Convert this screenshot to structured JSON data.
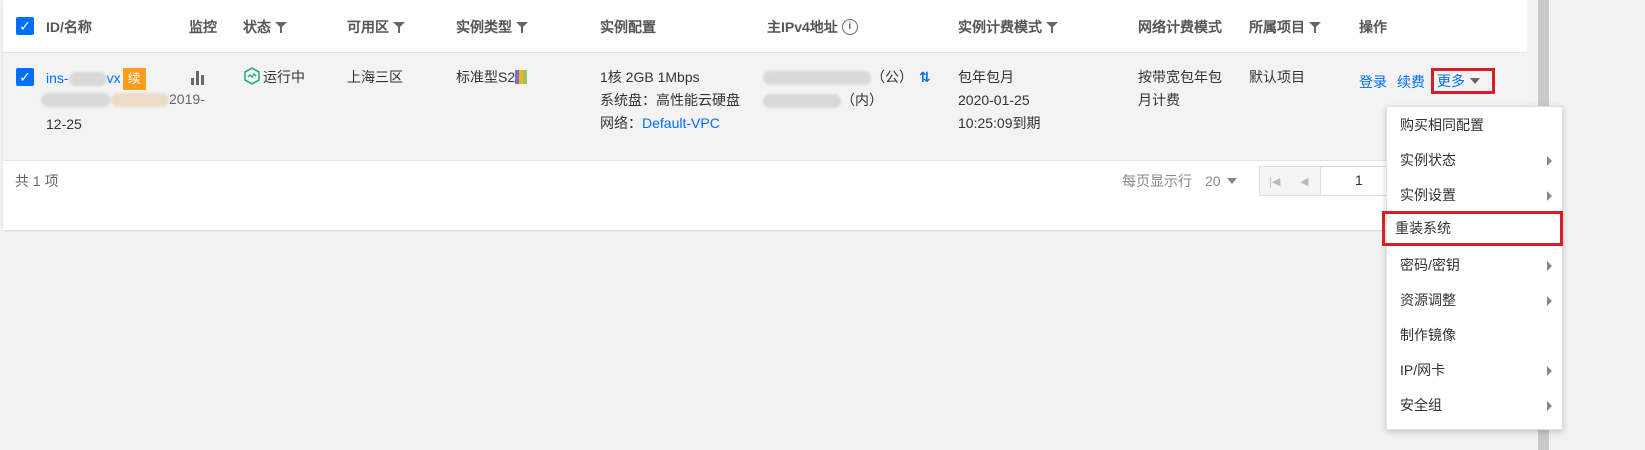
{
  "table": {
    "headers": {
      "id_name": "ID/名称",
      "monitor": "监控",
      "status": "状态",
      "zone": "可用区",
      "instance_type": "实例类型",
      "instance_config": "实例配置",
      "primary_ipv4": "主IPv4地址",
      "billing_mode": "实例计费模式",
      "network_billing": "网络计费模式",
      "project": "所属项目",
      "actions": "操作"
    },
    "row": {
      "id_prefix": "ins-",
      "id_suffix": "vx",
      "renew_badge": "续",
      "name_line2_tail": "2019-",
      "name_line3": "12-25",
      "status": "运行中",
      "zone": "上海三区",
      "instance_type": "标准型S2",
      "config_line1": "1核 2GB 1Mbps",
      "config_line2": "系统盘：高性能云硬盘",
      "config_line3_label": "网络：",
      "config_line3_link": "Default-VPC",
      "ip_public_suffix": "（公）",
      "ip_private_suffix": "（内）",
      "billing_line1": "包年包月",
      "billing_line2": "2020-01-25",
      "billing_line3": "10:25:09到期",
      "network_billing_line1": "按带宽包年包",
      "network_billing_line2": "月计费",
      "project": "默认项目",
      "action_login": "登录",
      "action_renew": "续费",
      "action_more": "更多"
    }
  },
  "footer": {
    "total": "共 1 项",
    "per_page_label": "每页显示行",
    "per_page_value": "20",
    "page_value": "1"
  },
  "menu": {
    "items": [
      {
        "label": "购买相同配置",
        "submenu": false
      },
      {
        "label": "实例状态",
        "submenu": true
      },
      {
        "label": "实例设置",
        "submenu": true
      },
      {
        "label": "重装系统",
        "submenu": false,
        "highlighted": true
      },
      {
        "label": "密码/密钥",
        "submenu": true
      },
      {
        "label": "资源调整",
        "submenu": true
      },
      {
        "label": "制作镜像",
        "submenu": false
      },
      {
        "label": "IP/网卡",
        "submenu": true
      },
      {
        "label": "安全组",
        "submenu": true
      }
    ]
  },
  "colors": {
    "link": "#006eff",
    "highlight_border": "#d71e27",
    "renew_badge": "#ff9c19",
    "status_running": "#28b474"
  }
}
